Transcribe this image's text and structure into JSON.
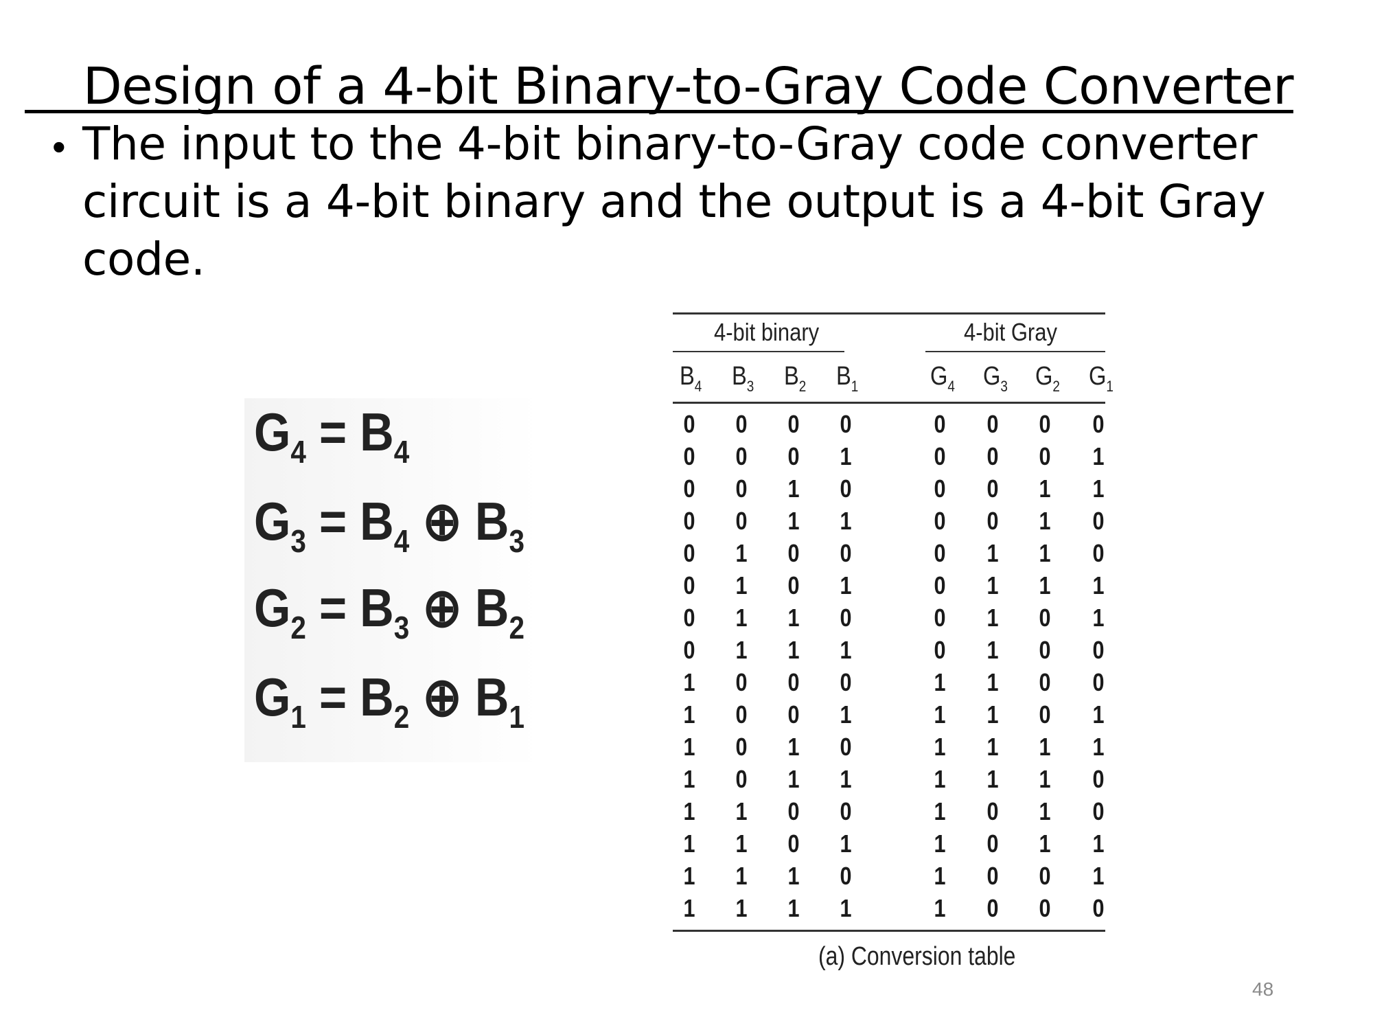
{
  "slide": {
    "title": "Design of a 4-bit Binary-to-Gray Code Converter",
    "bullet": "The input to the 4-bit binary-to-Gray code converter\ncircuit is a 4-bit binary and the output is a 4-bit Gray\ncode.",
    "page_number": "48"
  },
  "equations": [
    {
      "lhs": "G",
      "lhs_sub": "4",
      "rhs": [
        {
          "t": "B",
          "s": "4"
        }
      ]
    },
    {
      "lhs": "G",
      "lhs_sub": "3",
      "rhs": [
        {
          "t": "B",
          "s": "4"
        },
        {
          "op": "⊕"
        },
        {
          "t": "B",
          "s": "3"
        }
      ]
    },
    {
      "lhs": "G",
      "lhs_sub": "2",
      "rhs": [
        {
          "t": "B",
          "s": "3"
        },
        {
          "op": "⊕"
        },
        {
          "t": "B",
          "s": "2"
        }
      ]
    },
    {
      "lhs": "G",
      "lhs_sub": "1",
      "rhs": [
        {
          "t": "B",
          "s": "2"
        },
        {
          "op": "⊕"
        },
        {
          "t": "B",
          "s": "1"
        }
      ]
    }
  ],
  "table": {
    "group_binary": "4-bit binary",
    "group_gray": "4-bit Gray",
    "columns": [
      {
        "t": "B",
        "s": "4"
      },
      {
        "t": "B",
        "s": "3"
      },
      {
        "t": "B",
        "s": "2"
      },
      {
        "t": "B",
        "s": "1"
      },
      {
        "t": "G",
        "s": "4"
      },
      {
        "t": "G",
        "s": "3"
      },
      {
        "t": "G",
        "s": "2"
      },
      {
        "t": "G",
        "s": "1"
      }
    ],
    "rows": [
      [
        "0",
        "0",
        "0",
        "0",
        "0",
        "0",
        "0",
        "0"
      ],
      [
        "0",
        "0",
        "0",
        "1",
        "0",
        "0",
        "0",
        "1"
      ],
      [
        "0",
        "0",
        "1",
        "0",
        "0",
        "0",
        "1",
        "1"
      ],
      [
        "0",
        "0",
        "1",
        "1",
        "0",
        "0",
        "1",
        "0"
      ],
      [
        "0",
        "1",
        "0",
        "0",
        "0",
        "1",
        "1",
        "0"
      ],
      [
        "0",
        "1",
        "0",
        "1",
        "0",
        "1",
        "1",
        "1"
      ],
      [
        "0",
        "1",
        "1",
        "0",
        "0",
        "1",
        "0",
        "1"
      ],
      [
        "0",
        "1",
        "1",
        "1",
        "0",
        "1",
        "0",
        "0"
      ],
      [
        "1",
        "0",
        "0",
        "0",
        "1",
        "1",
        "0",
        "0"
      ],
      [
        "1",
        "0",
        "0",
        "1",
        "1",
        "1",
        "0",
        "1"
      ],
      [
        "1",
        "0",
        "1",
        "0",
        "1",
        "1",
        "1",
        "1"
      ],
      [
        "1",
        "0",
        "1",
        "1",
        "1",
        "1",
        "1",
        "0"
      ],
      [
        "1",
        "1",
        "0",
        "0",
        "1",
        "0",
        "1",
        "0"
      ],
      [
        "1",
        "1",
        "0",
        "1",
        "1",
        "0",
        "1",
        "1"
      ],
      [
        "1",
        "1",
        "1",
        "0",
        "1",
        "0",
        "0",
        "1"
      ],
      [
        "1",
        "1",
        "1",
        "1",
        "1",
        "0",
        "0",
        "0"
      ]
    ],
    "caption": "(a) Conversion table"
  }
}
